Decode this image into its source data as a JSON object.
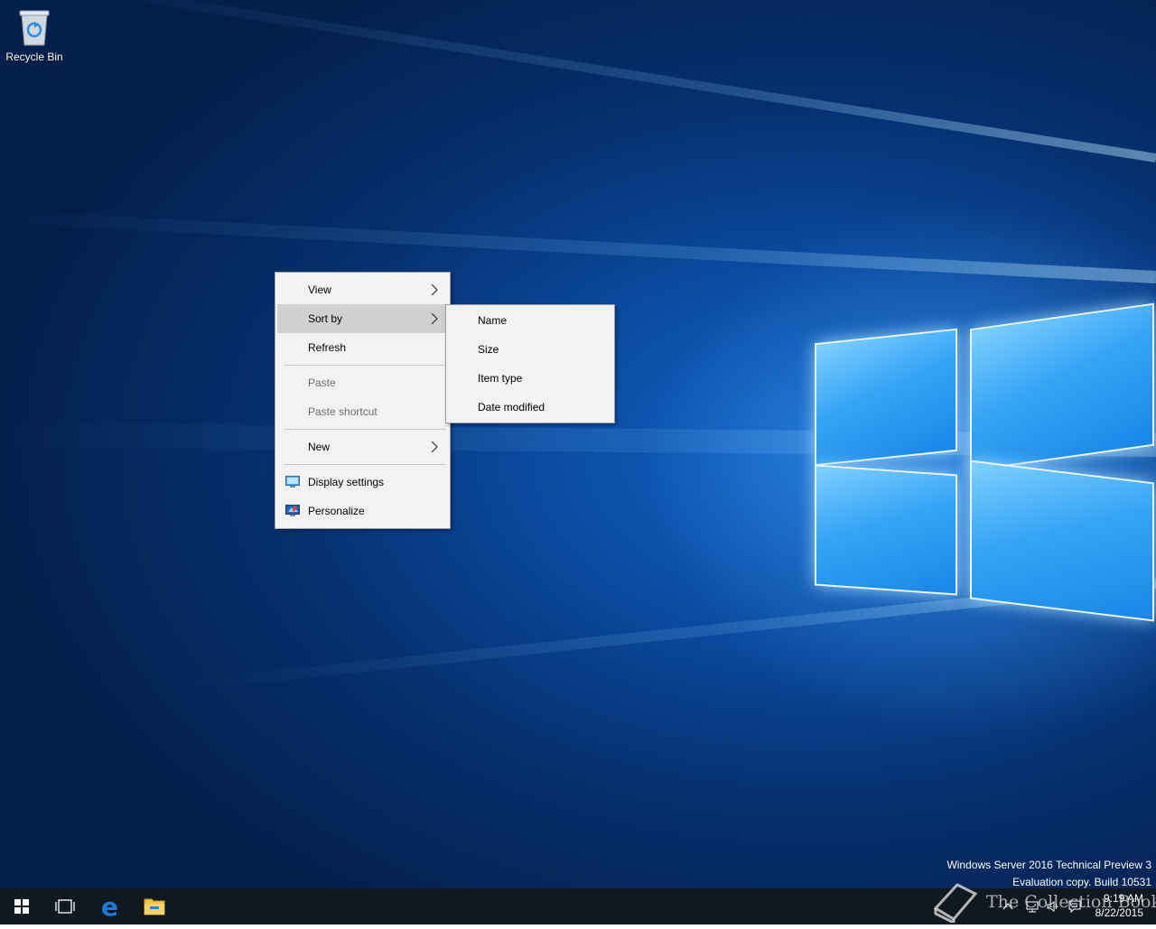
{
  "desktop": {
    "icons": [
      {
        "label": "Recycle Bin",
        "icon": "recycle-bin-icon"
      }
    ]
  },
  "context_menu": {
    "items": [
      {
        "label": "View",
        "has_submenu": true,
        "enabled": true
      },
      {
        "label": "Sort by",
        "has_submenu": true,
        "enabled": true,
        "highlighted": true
      },
      {
        "label": "Refresh",
        "enabled": true
      },
      {
        "label": "Paste",
        "enabled": false
      },
      {
        "label": "Paste shortcut",
        "enabled": false
      },
      {
        "label": "New",
        "has_submenu": true,
        "enabled": true
      },
      {
        "label": "Display settings",
        "icon": "display-settings-icon",
        "enabled": true
      },
      {
        "label": "Personalize",
        "icon": "personalize-icon",
        "enabled": true
      }
    ]
  },
  "sort_submenu": {
    "items": [
      {
        "label": "Name"
      },
      {
        "label": "Size"
      },
      {
        "label": "Item type"
      },
      {
        "label": "Date modified"
      }
    ]
  },
  "watermark": {
    "line1": "Windows Server 2016 Technical Preview 3",
    "line2": "Evaluation copy. Build 10531"
  },
  "taskbar": {
    "buttons": [
      "start-icon",
      "task-view-icon",
      "edge-icon",
      "file-explorer-icon"
    ],
    "clock": {
      "time": "9:19 AM",
      "date": "8/22/2015"
    }
  },
  "overlay": {
    "text": "The Collection Book"
  },
  "colors": {
    "taskbar": "#101820",
    "menu_bg": "#f2f2f2",
    "menu_highlight": "#d0d0d0",
    "edge_blue": "#1e7ad8",
    "explorer_yellow": "#f3c441"
  }
}
